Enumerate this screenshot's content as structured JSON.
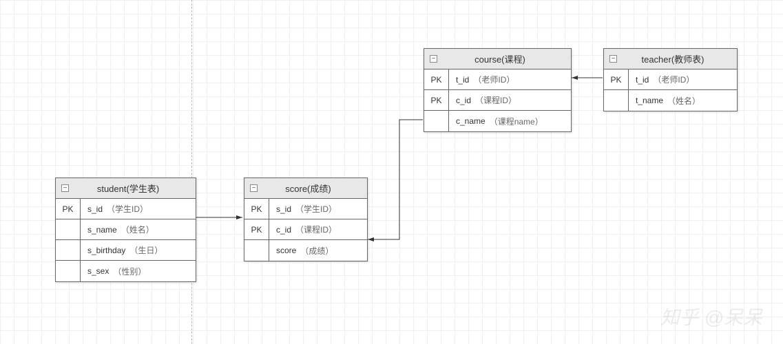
{
  "entities": {
    "student": {
      "title": "student(学生表)",
      "fields": [
        {
          "pk": "PK",
          "name": "s_id",
          "note": "（学生ID）"
        },
        {
          "pk": "",
          "name": "s_name",
          "note": "（姓名）"
        },
        {
          "pk": "",
          "name": "s_birthday",
          "note": "（生日）"
        },
        {
          "pk": "",
          "name": "s_sex",
          "note": "（性别）"
        }
      ]
    },
    "score": {
      "title": "score(成绩)",
      "fields": [
        {
          "pk": "PK",
          "name": "s_id",
          "note": "（学生ID）"
        },
        {
          "pk": "PK",
          "name": "c_id",
          "note": "（课程ID）"
        },
        {
          "pk": "",
          "name": "score",
          "note": "（成绩）"
        }
      ]
    },
    "course": {
      "title": "course(课程)",
      "fields": [
        {
          "pk": "PK",
          "name": "t_id",
          "note": "（老师ID）"
        },
        {
          "pk": "PK",
          "name": "c_id",
          "note": "（课程ID）"
        },
        {
          "pk": "",
          "name": "c_name",
          "note": "（课程name）"
        }
      ]
    },
    "teacher": {
      "title": "teacher(教师表)",
      "fields": [
        {
          "pk": "PK",
          "name": "t_id",
          "note": "（老师ID）"
        },
        {
          "pk": "",
          "name": "t_name",
          "note": "（姓名）"
        }
      ]
    }
  },
  "collapse_glyph": "−",
  "watermark": "知乎 @呆呆"
}
